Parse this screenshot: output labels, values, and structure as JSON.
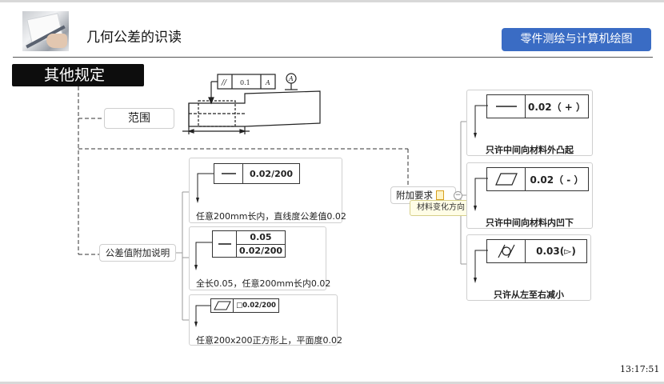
{
  "header": {
    "title": "几何公差的识读",
    "badge": "零件测绘与计算机绘图"
  },
  "section_title": "其他规定",
  "drawing": {
    "symbol": "//",
    "value": "0.1",
    "datum": "A",
    "datum_marker": "A"
  },
  "nodes": {
    "range": "范围",
    "tolerance_note": "公差值附加说明",
    "additional_req": "附加要求",
    "tooltip": "材料变化方向"
  },
  "left_cards": [
    {
      "frame_value": "0.02/200",
      "caption": "任意200mm长内，直线度公差值0.02"
    },
    {
      "frame_value_top": "0.05",
      "frame_value_bottom": "0.02/200",
      "caption": "全长0.05，任意200mm长内0.02"
    },
    {
      "frame_value": "□0.02/200",
      "caption": "任意200x200正方形上，平面度0.02"
    }
  ],
  "right_cards": [
    {
      "frame_value": "0.02（ + ）",
      "caption": "只许中间向材料外凸起"
    },
    {
      "frame_value": "0.02（ - ）",
      "caption": "只许中间向材料内凹下"
    },
    {
      "frame_value": "0.03(▻)",
      "caption": "只许从左至右减小"
    }
  ],
  "footer": {
    "time": "13:17:51"
  },
  "icons": [
    "straightness-icon",
    "flatness-icon",
    "cylindricity-icon",
    "note-icon",
    "collapse-icon"
  ]
}
